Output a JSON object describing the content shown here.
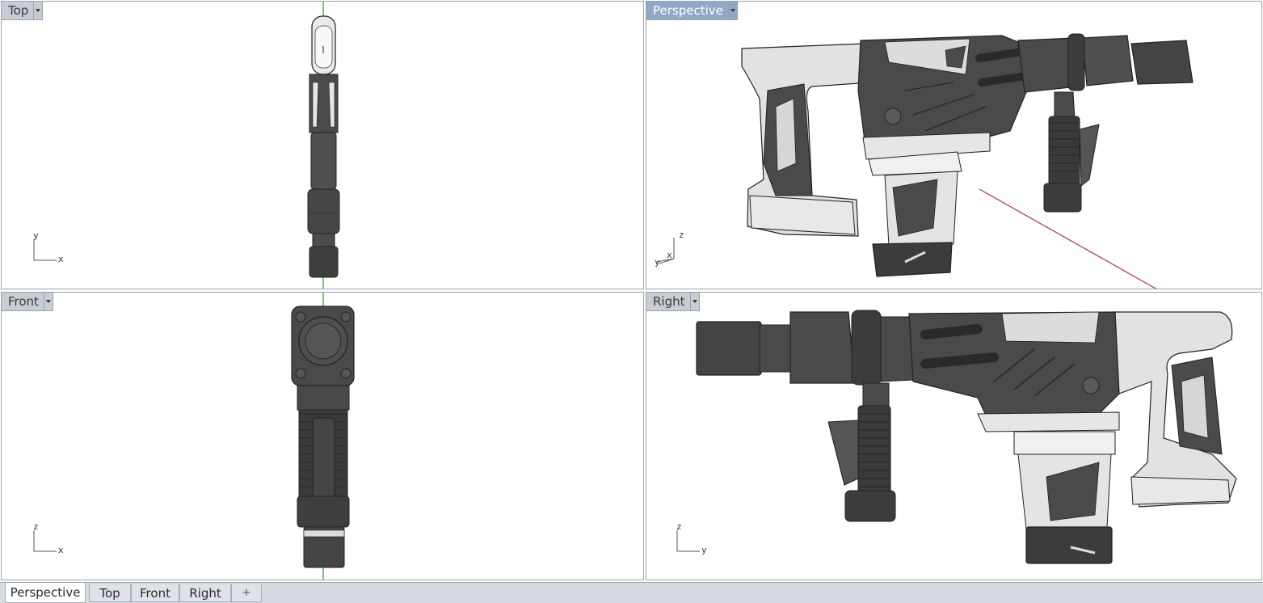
{
  "viewports": {
    "top": {
      "label": "Top",
      "axis_h": "x",
      "axis_v": "y"
    },
    "perspective": {
      "label": "Perspective",
      "axis_v": "z",
      "axis_a": "y",
      "axis_b": "x"
    },
    "front": {
      "label": "Front",
      "axis_h": "x",
      "axis_v": "z"
    },
    "right": {
      "label": "Right",
      "axis_h": "y",
      "axis_v": "z"
    }
  },
  "tabs": [
    {
      "label": "Perspective",
      "active": true
    },
    {
      "label": "Top",
      "active": false
    },
    {
      "label": "Front",
      "active": false
    },
    {
      "label": "Right",
      "active": false
    }
  ],
  "add_tab_glyph": "+",
  "colors": {
    "active_label": "#8fa8c8",
    "inactive_label": "#c8cdd4",
    "axis_y_green": "#2a9d2a",
    "axis_x_red": "#a33a3a",
    "model_dark": "#4a4a4a",
    "model_light": "#e2e2e2"
  }
}
